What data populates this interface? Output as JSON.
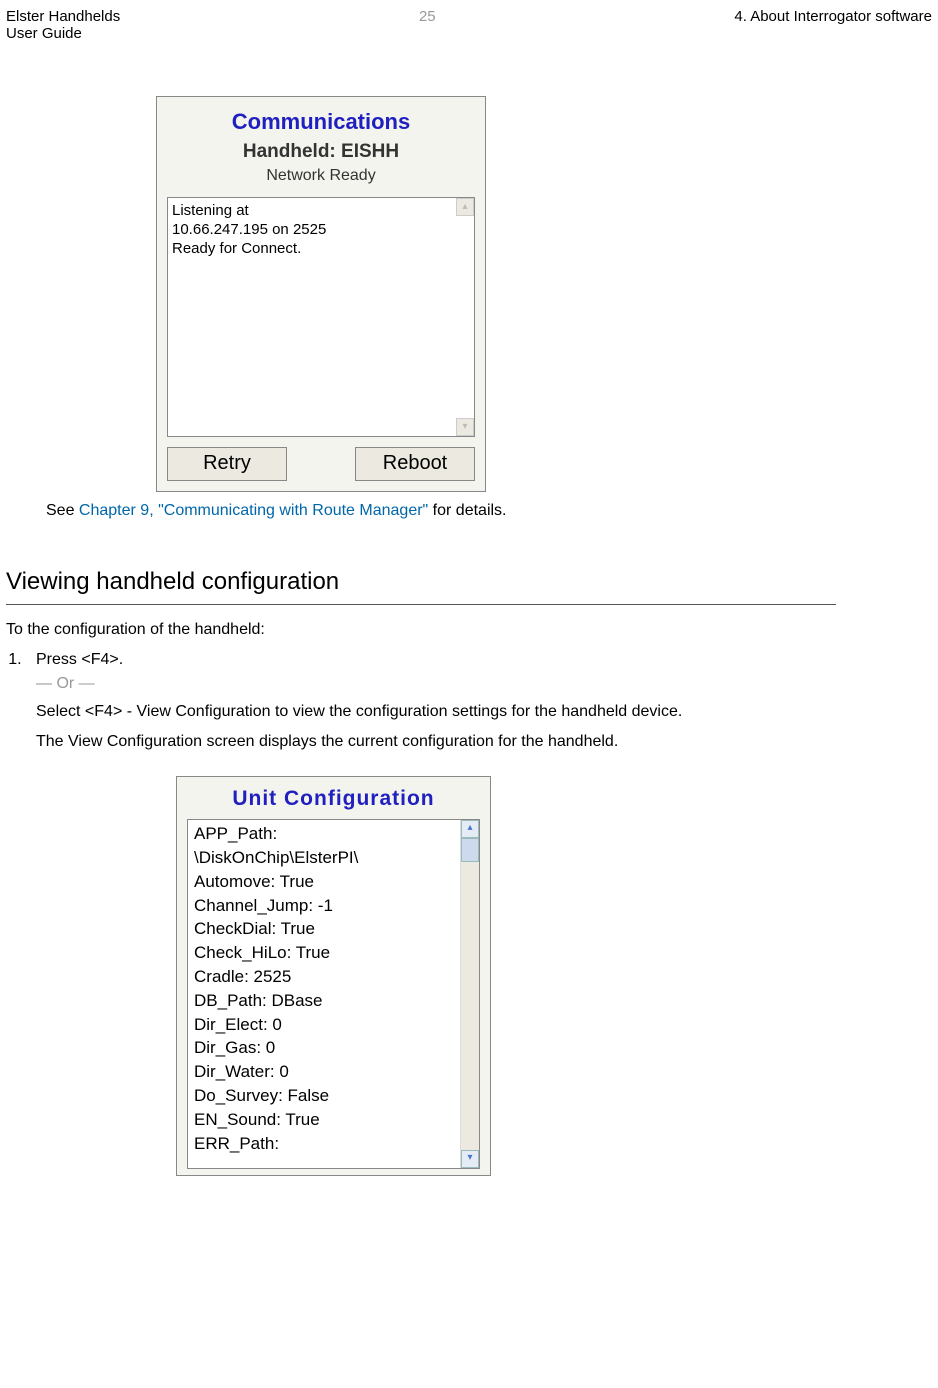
{
  "header": {
    "left_line1": "Elster Handhelds",
    "left_line2": "User Guide",
    "center": "25",
    "right": "4. About Interrogator software"
  },
  "screenshot1": {
    "title": "Communications",
    "subtitle1": "Handheld: EISHH",
    "subtitle2": "Network Ready",
    "textbox_line1": "Listening at",
    "textbox_line2": "10.66.247.195 on 2525",
    "textbox_line3": "Ready for Connect.",
    "btn_retry": "Retry",
    "btn_reboot": "Reboot"
  },
  "see_text_pre": "See ",
  "see_link": "Chapter 9, \"Communicating with Route Manager\"",
  "see_text_post": " for details.",
  "section_title": "Viewing handheld configuration",
  "intro": "To the configuration of the handheld:",
  "step1_a": "Press <F4>.",
  "step1_or": "— Or —",
  "step1_b_pre": "Select ",
  "step1_b_bold": "<F4> - View Configuration",
  "step1_b_post": " to view the configuration settings for the handheld device.",
  "step1_c": "The View Configuration screen displays the current configuration for the handheld.",
  "screenshot2": {
    "title": "Unit  Configuration",
    "lines": [
      "APP_Path:",
      "\\DiskOnChip\\ElsterPI\\",
      "Automove: True",
      "Channel_Jump: -1",
      "CheckDial: True",
      "Check_HiLo: True",
      "Cradle: 2525",
      "DB_Path: DBase",
      "Dir_Elect: 0",
      "Dir_Gas: 0",
      "Dir_Water: 0",
      "Do_Survey: False",
      "EN_Sound: True",
      "ERR_Path:"
    ]
  }
}
